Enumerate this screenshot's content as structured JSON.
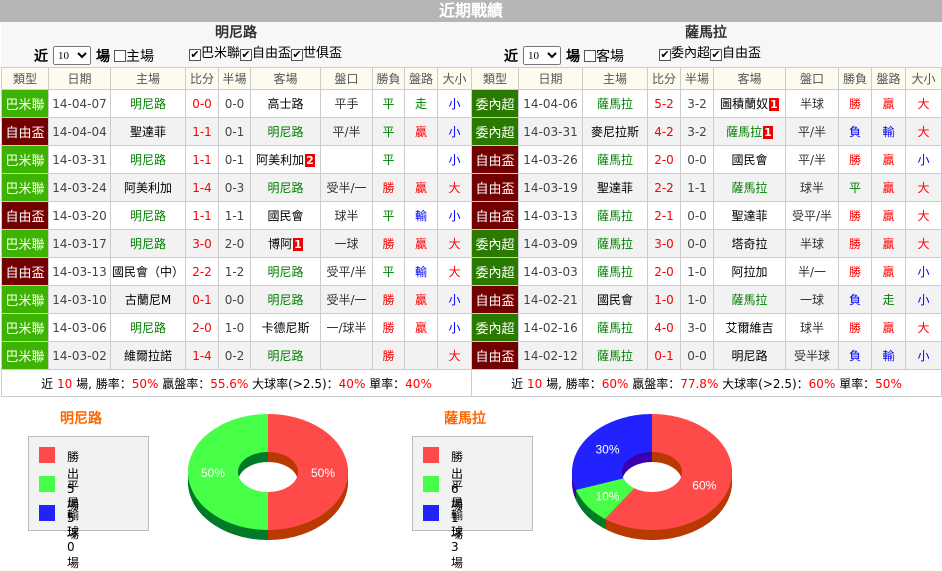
{
  "header": {
    "title": "近期戰績"
  },
  "colors": {
    "巴米聯": "#3cb300",
    "自由盃": "#720000",
    "委內超": "#2a7a00",
    "win": "#ff4a4a",
    "draw": "#46ff46",
    "loss": "#2222ff"
  },
  "columns": [
    "類型",
    "日期",
    "主場",
    "比分",
    "半場",
    "客場",
    "盤口",
    "勝負",
    "盤路",
    "大小"
  ],
  "panels": [
    {
      "team": "明尼路",
      "near_label": "近",
      "count": "10",
      "chang_label": "場",
      "venue_label": "主場",
      "venue_checked": false,
      "leagues": [
        {
          "name": "巴米聯",
          "checked": true
        },
        {
          "name": "自由盃",
          "checked": true
        },
        {
          "name": "世俱盃",
          "checked": true
        }
      ],
      "rows": [
        {
          "type": "巴米聯",
          "date": "14-04-07",
          "home": "明尼路",
          "hh": true,
          "hb": "",
          "score": "0-0",
          "half": "0-0",
          "away": "高士路",
          "ah": false,
          "ab": "",
          "hcp": "平手",
          "res": "平",
          "pan": "走",
          "ou": "小"
        },
        {
          "type": "自由盃",
          "date": "14-04-04",
          "home": "聖達菲",
          "hh": false,
          "hb": "",
          "score": "1-1",
          "half": "0-1",
          "away": "明尼路",
          "ah": true,
          "ab": "",
          "hcp": "平/半",
          "res": "平",
          "pan": "贏",
          "ou": "小"
        },
        {
          "type": "巴米聯",
          "date": "14-03-31",
          "home": "明尼路",
          "hh": true,
          "hb": "",
          "score": "1-1",
          "half": "0-1",
          "away": "阿美利加",
          "ah": false,
          "ab": "2",
          "hcp": "",
          "res": "平",
          "pan": "",
          "ou": "小"
        },
        {
          "type": "巴米聯",
          "date": "14-03-24",
          "home": "阿美利加",
          "hh": false,
          "hb": "",
          "score": "1-4",
          "half": "0-3",
          "away": "明尼路",
          "ah": true,
          "ab": "",
          "hcp": "受半/一",
          "res": "勝",
          "pan": "贏",
          "ou": "大"
        },
        {
          "type": "自由盃",
          "date": "14-03-20",
          "home": "明尼路",
          "hh": true,
          "hb": "",
          "score": "1-1",
          "half": "1-1",
          "away": "國民會",
          "ah": false,
          "ab": "",
          "hcp": "球半",
          "res": "平",
          "pan": "輸",
          "ou": "小"
        },
        {
          "type": "巴米聯",
          "date": "14-03-17",
          "home": "明尼路",
          "hh": true,
          "hb": "",
          "score": "3-0",
          "half": "2-0",
          "away": "博阿",
          "ah": false,
          "ab": "1",
          "hcp": "一球",
          "res": "勝",
          "pan": "贏",
          "ou": "大"
        },
        {
          "type": "自由盃",
          "date": "14-03-13",
          "home": "國民會（中）",
          "hh": false,
          "hb": "",
          "score": "2-2",
          "half": "1-2",
          "away": "明尼路",
          "ah": true,
          "ab": "",
          "hcp": "受平/半",
          "res": "平",
          "pan": "輸",
          "ou": "大"
        },
        {
          "type": "巴米聯",
          "date": "14-03-10",
          "home": "古蘭尼M",
          "hh": false,
          "hb": "",
          "score": "0-1",
          "half": "0-0",
          "away": "明尼路",
          "ah": true,
          "ab": "",
          "hcp": "受半/一",
          "res": "勝",
          "pan": "贏",
          "ou": "小"
        },
        {
          "type": "巴米聯",
          "date": "14-03-06",
          "home": "明尼路",
          "hh": true,
          "hb": "",
          "score": "2-0",
          "half": "1-0",
          "away": "卡德尼斯",
          "ah": false,
          "ab": "",
          "hcp": "一/球半",
          "res": "勝",
          "pan": "贏",
          "ou": "小"
        },
        {
          "type": "巴米聯",
          "date": "14-03-02",
          "home": "維爾拉諾",
          "hh": false,
          "hb": "",
          "score": "1-4",
          "half": "0-2",
          "away": "明尼路",
          "ah": true,
          "ab": "",
          "hcp": "",
          "res": "勝",
          "pan": "",
          "ou": "大"
        }
      ],
      "summary": {
        "p1": "近 ",
        "n": "10",
        "p2": " 場, 勝率：",
        "win": "50%",
        "p3": " 贏盤率：",
        "pan": "55.6%",
        "p4": " 大球率(>2.5)：",
        "big": "40%",
        "p5": " 單率：",
        "odd": "40%"
      },
      "chart": {
        "title": "明尼路",
        "legend": [
          "勝出5場",
          "平局5場",
          "輸球0場"
        ],
        "values": [
          50,
          50,
          0
        ],
        "labels": [
          "50%",
          "50%",
          ""
        ]
      }
    },
    {
      "team": "薩馬拉",
      "near_label": "近",
      "count": "10",
      "chang_label": "場",
      "venue_label": "客場",
      "venue_checked": false,
      "leagues": [
        {
          "name": "委內超",
          "checked": true
        },
        {
          "name": "自由盃",
          "checked": true
        }
      ],
      "rows": [
        {
          "type": "委內超",
          "date": "14-04-06",
          "home": "薩馬拉",
          "hh": true,
          "hb": "",
          "score": "5-2",
          "half": "3-2",
          "away": "圖積蘭奴",
          "ah": false,
          "ab": "1",
          "hcp": "半球",
          "res": "勝",
          "pan": "贏",
          "ou": "大"
        },
        {
          "type": "委內超",
          "date": "14-03-31",
          "home": "麥尼拉斯",
          "hh": false,
          "hb": "",
          "score": "4-2",
          "half": "3-2",
          "away": "薩馬拉",
          "ah": true,
          "ab": "1",
          "hcp": "平/半",
          "res": "負",
          "pan": "輸",
          "ou": "大"
        },
        {
          "type": "自由盃",
          "date": "14-03-26",
          "home": "薩馬拉",
          "hh": true,
          "hb": "",
          "score": "2-0",
          "half": "0-0",
          "away": "國民會",
          "ah": false,
          "ab": "",
          "hcp": "平/半",
          "res": "勝",
          "pan": "贏",
          "ou": "小"
        },
        {
          "type": "自由盃",
          "date": "14-03-19",
          "home": "聖達菲",
          "hh": false,
          "hb": "",
          "score": "2-2",
          "half": "1-1",
          "away": "薩馬拉",
          "ah": true,
          "ab": "",
          "hcp": "球半",
          "res": "平",
          "pan": "贏",
          "ou": "大"
        },
        {
          "type": "自由盃",
          "date": "14-03-13",
          "home": "薩馬拉",
          "hh": true,
          "hb": "",
          "score": "2-1",
          "half": "0-0",
          "away": "聖達菲",
          "ah": false,
          "ab": "",
          "hcp": "受平/半",
          "res": "勝",
          "pan": "贏",
          "ou": "大"
        },
        {
          "type": "委內超",
          "date": "14-03-09",
          "home": "薩馬拉",
          "hh": true,
          "hb": "",
          "score": "3-0",
          "half": "0-0",
          "away": "塔奇拉",
          "ah": false,
          "ab": "",
          "hcp": "半球",
          "res": "勝",
          "pan": "贏",
          "ou": "大"
        },
        {
          "type": "委內超",
          "date": "14-03-03",
          "home": "薩馬拉",
          "hh": true,
          "hb": "",
          "score": "2-0",
          "half": "1-0",
          "away": "阿拉加",
          "ah": false,
          "ab": "",
          "hcp": "半/一",
          "res": "勝",
          "pan": "贏",
          "ou": "小"
        },
        {
          "type": "自由盃",
          "date": "14-02-21",
          "home": "國民會",
          "hh": false,
          "hb": "",
          "score": "1-0",
          "half": "1-0",
          "away": "薩馬拉",
          "ah": true,
          "ab": "",
          "hcp": "一球",
          "res": "負",
          "pan": "走",
          "ou": "小"
        },
        {
          "type": "委內超",
          "date": "14-02-16",
          "home": "薩馬拉",
          "hh": true,
          "hb": "",
          "score": "4-0",
          "half": "3-0",
          "away": "艾爾維吉",
          "ah": false,
          "ab": "",
          "hcp": "球半",
          "res": "勝",
          "pan": "贏",
          "ou": "大"
        },
        {
          "type": "自由盃",
          "date": "14-02-12",
          "home": "薩馬拉",
          "hh": true,
          "hb": "",
          "score": "0-1",
          "half": "0-0",
          "away": "明尼路",
          "ah": false,
          "ab": "",
          "hcp": "受半球",
          "res": "負",
          "pan": "輸",
          "ou": "小"
        }
      ],
      "summary": {
        "p1": "近 ",
        "n": "10",
        "p2": " 場, 勝率：",
        "win": "60%",
        "p3": " 贏盤率：",
        "pan": "77.8%",
        "p4": " 大球率(>2.5)：",
        "big": "60%",
        "p5": " 單率：",
        "odd": "50%"
      },
      "chart": {
        "title": "薩馬拉",
        "legend": [
          "勝出6場",
          "平局1場",
          "輸球3場"
        ],
        "values": [
          60,
          10,
          30
        ],
        "labels": [
          "60%",
          "10%",
          "30%"
        ]
      }
    }
  ]
}
